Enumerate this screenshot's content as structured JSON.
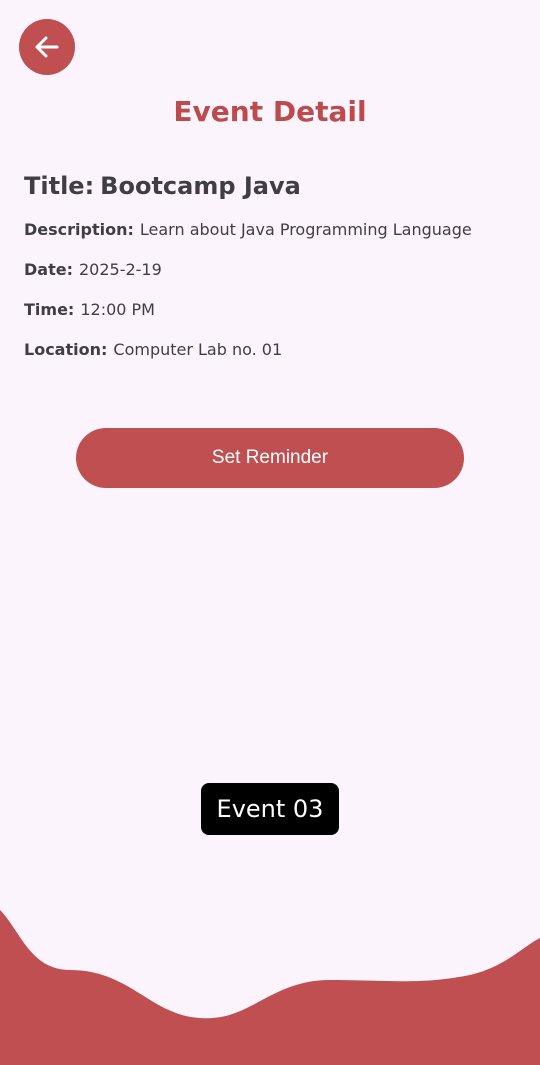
{
  "header": {
    "back_icon": "arrow-left-icon",
    "title": "Event Detail"
  },
  "event": {
    "title_label": "Title:",
    "title_value": "Bootcamp Java",
    "description_label": "Description:",
    "description_value": "Learn about Java Programming Language",
    "date_label": "Date:",
    "date_value": "2025-2-19",
    "time_label": "Time:",
    "time_value": "12:00 PM",
    "location_label": "Location:",
    "location_value": "Computer Lab no. 01"
  },
  "actions": {
    "set_reminder_label": "Set Reminder"
  },
  "toast": {
    "text": "Event 03"
  },
  "colors": {
    "accent": "#bf4f50",
    "background": "#fcf4fc",
    "text": "#3f3d45"
  }
}
